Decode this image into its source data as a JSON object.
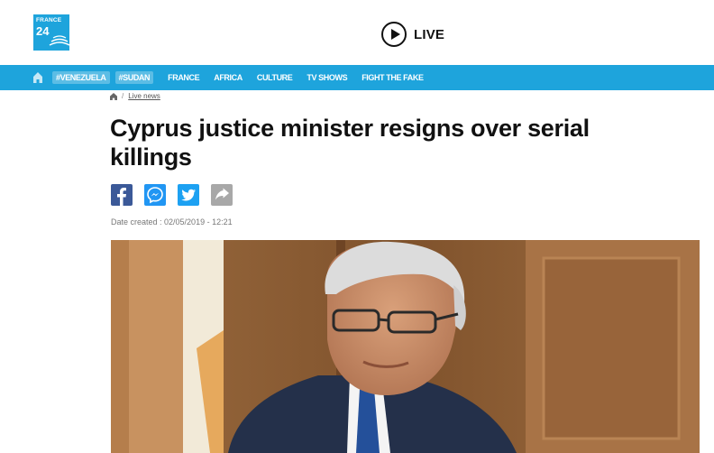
{
  "brand": {
    "logo_line1": "FRANCE",
    "logo_line2": "24"
  },
  "live": {
    "label": "LIVE"
  },
  "nav": {
    "items": [
      "#VENEZUELA",
      "#SUDAN",
      "FRANCE",
      "AFRICA",
      "CULTURE",
      "TV SHOWS",
      "FIGHT THE FAKE"
    ]
  },
  "breadcrumb": {
    "separator": "/",
    "crumb": "Live news"
  },
  "article": {
    "headline": "Cyprus justice minister resigns over serial killings",
    "date": "Date created : 02/05/2019 - 12:21"
  },
  "colors": {
    "brand_blue": "#1ea4dc",
    "facebook": "#3b5998",
    "messenger": "#2196f3",
    "twitter": "#1da1f2",
    "share": "#a8a8a8"
  },
  "icons": [
    "home-icon",
    "play-icon",
    "facebook-icon",
    "messenger-icon",
    "twitter-icon",
    "share-icon"
  ]
}
